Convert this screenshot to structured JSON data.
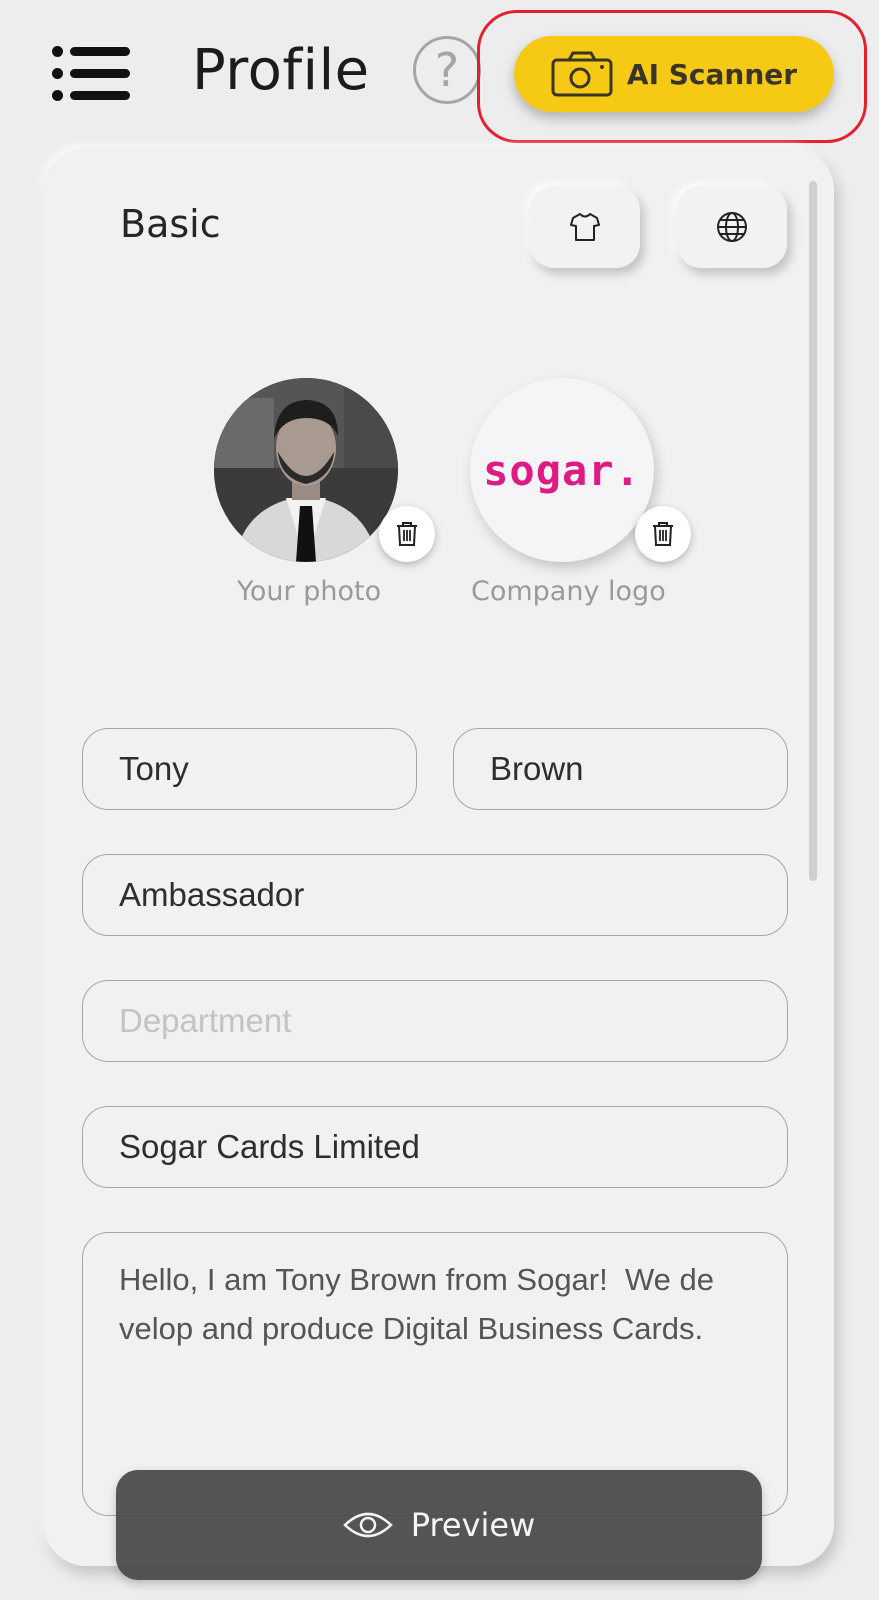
{
  "header": {
    "menu_icon": "hamburger-menu-icon",
    "title": "Profile",
    "help_icon": "question-circle-icon",
    "help_symbol": "?",
    "scanner_icon": "camera-icon",
    "scanner_label": "AI Scanner",
    "scanner_color": "#f6c915",
    "highlight_color": "#e2212c"
  },
  "basic": {
    "title": "Basic",
    "shirt_icon": "tshirt-icon",
    "globe_icon": "globe-icon"
  },
  "media": {
    "photo_caption": "Your photo",
    "logo_caption": "Company logo",
    "logo_text": "sogar.",
    "logo_color": "#e01a83",
    "trash_icon": "trash-icon"
  },
  "form": {
    "first_name": "Tony",
    "last_name": "Brown",
    "job_title": "Ambassador",
    "department_placeholder": "Department",
    "company": "Sogar Cards Limited",
    "bio": "Hello, I am Tony Brown from Sogar!  We de velop and produce Digital Business Cards."
  },
  "preview": {
    "icon": "eye-icon",
    "label": "Preview"
  }
}
